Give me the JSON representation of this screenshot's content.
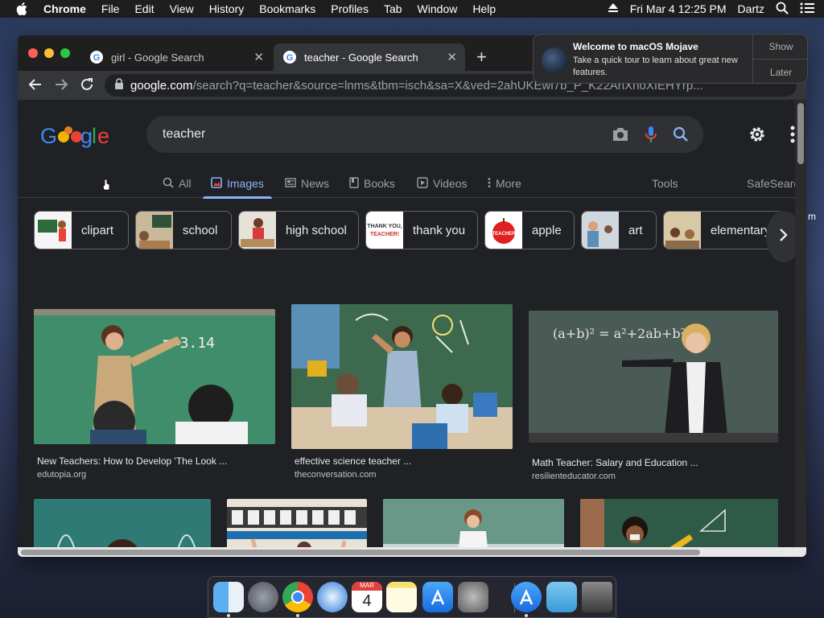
{
  "menubar": {
    "app": "Chrome",
    "items": [
      "File",
      "Edit",
      "View",
      "History",
      "Bookmarks",
      "Profiles",
      "Tab",
      "Window",
      "Help"
    ],
    "clock": "Fri Mar 4  12:25 PM",
    "user": "Dartz"
  },
  "tabs": [
    {
      "title": "girl - Google Search"
    },
    {
      "title": "teacher - Google Search"
    }
  ],
  "address": {
    "host": "google.com",
    "path": "/search?q=teacher&source=lnms&tbm=isch&sa=X&ved=2ahUKEwi7b_P_K22AhXhoXIEHYrp..."
  },
  "search": {
    "query": "teacher",
    "tabs": [
      "All",
      "Images",
      "News",
      "Books",
      "Videos",
      "More"
    ],
    "active_tab": "Images",
    "tools": "Tools",
    "safesearch": "SafeSearch"
  },
  "chips": [
    "clipart",
    "school",
    "high school",
    "thank you",
    "apple",
    "art",
    "elementary"
  ],
  "chip_thumb_texts": {
    "thankyou": "THANK YOU, TEACHER!",
    "apple": "TEACHER"
  },
  "results": [
    {
      "title": "New Teachers: How to Develop 'The Look ...",
      "source": "edutopia.org",
      "board_text": "π=3.14"
    },
    {
      "title": "effective science teacher ...",
      "source": "theconversation.com"
    },
    {
      "title": "Math Teacher: Salary and Education ...",
      "source": "resilienteducator.com",
      "board_text": "(a+b)² = a²+2ab+b²"
    },
    {
      "title": "",
      "source": ""
    },
    {
      "title": "",
      "source": ""
    },
    {
      "title": "",
      "source": ""
    },
    {
      "title": "",
      "source": ""
    }
  ],
  "notification": {
    "title": "Welcome to macOS Mojave",
    "body": "Take a quick tour to learn about great new features.",
    "show": "Show",
    "later": "Later"
  },
  "calendar": {
    "month": "MAR",
    "day": "4"
  },
  "side_text": "m",
  "colors": {
    "accent": "#8ab4f8",
    "page_bg": "#202124",
    "chrome_toolbar": "#35363a"
  }
}
